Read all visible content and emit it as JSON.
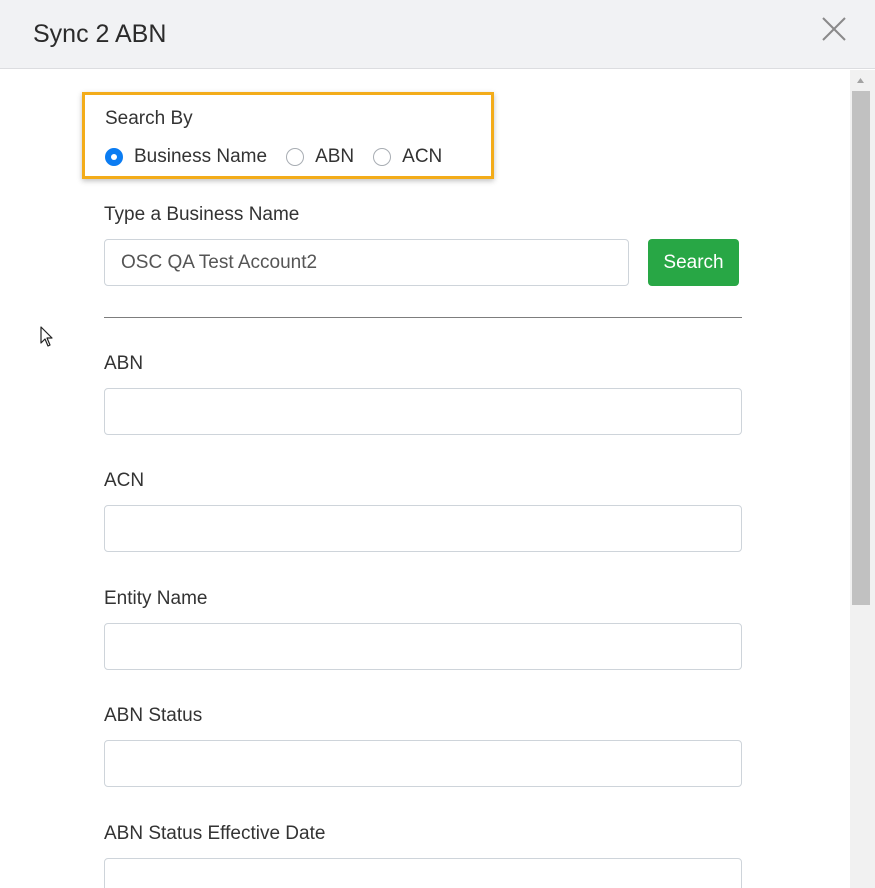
{
  "dialog": {
    "title": "Sync 2 ABN"
  },
  "search_by": {
    "label": "Search By",
    "options": [
      {
        "label": "Business Name",
        "checked": true
      },
      {
        "label": "ABN",
        "checked": false
      },
      {
        "label": "ACN",
        "checked": false
      }
    ]
  },
  "business_search": {
    "label": "Type a Business Name",
    "value": "OSC QA Test Account2",
    "button_label": "Search"
  },
  "fields": {
    "abn": {
      "label": "ABN",
      "value": ""
    },
    "acn": {
      "label": "ACN",
      "value": ""
    },
    "entity_name": {
      "label": "Entity Name",
      "value": ""
    },
    "abn_status": {
      "label": "ABN Status",
      "value": ""
    },
    "abn_status_effective_date": {
      "label": "ABN Status Effective Date",
      "value": ""
    }
  },
  "colors": {
    "accent_blue": "#0b7cf2",
    "search_green": "#28a745",
    "highlight_orange": "#f3ac1a",
    "header_bg": "#f1f2f4"
  },
  "icons": {
    "close": "close-icon",
    "scroll_up": "chevron-up-icon",
    "cursor": "mouse-pointer-icon"
  }
}
